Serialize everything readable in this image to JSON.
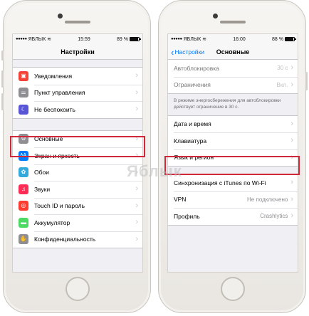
{
  "watermark": "Яблык",
  "left_phone": {
    "status": {
      "carrier": "ЯБЛЫК",
      "time": "15:59",
      "battery_text": "89 %",
      "battery_level": 0.89
    },
    "nav": {
      "title": "Настройки"
    },
    "groups": [
      [
        {
          "label": "Уведомления",
          "icon": "notifications-icon",
          "color": "#f44336",
          "glyph": "▣"
        },
        {
          "label": "Пункт управления",
          "icon": "control-center-icon",
          "color": "#8e8e93",
          "glyph": "⚌"
        },
        {
          "label": "Не беспокоить",
          "icon": "moon-icon",
          "color": "#5856d6",
          "glyph": "☾"
        }
      ],
      [
        {
          "label": "Основные",
          "icon": "gear-icon",
          "color": "#8e8e93",
          "glyph": "⚙"
        },
        {
          "label": "Экран и яркость",
          "icon": "display-brightness-icon",
          "color": "#007aff",
          "glyph": "ᴬA"
        },
        {
          "label": "Обои",
          "icon": "wallpaper-icon",
          "color": "#34aadc",
          "glyph": "✿"
        },
        {
          "label": "Звуки",
          "icon": "sound-icon",
          "color": "#ff2d55",
          "glyph": "♫"
        },
        {
          "label": "Touch ID и пароль",
          "icon": "fingerprint-icon",
          "color": "#ff3b30",
          "glyph": "◎"
        },
        {
          "label": "Аккумулятор",
          "icon": "battery-icon",
          "color": "#4cd964",
          "glyph": "▬"
        },
        {
          "label": "Конфиденциальность",
          "icon": "privacy-hand-icon",
          "color": "#8e8e93",
          "glyph": "✋"
        }
      ]
    ]
  },
  "right_phone": {
    "status": {
      "carrier": "ЯБЛЫК",
      "time": "16:00",
      "battery_text": "88 %",
      "battery_level": 0.88
    },
    "nav": {
      "back": "Настройки",
      "title": "Основные"
    },
    "group1": [
      {
        "label": "Автоблокировка",
        "value": "30 с"
      },
      {
        "label": "Ограничения",
        "value": "Вкл."
      }
    ],
    "note": "В режиме энергосбережения для автоблокировки действует ограничение в 30 с.",
    "group2": [
      {
        "label": "Дата и время",
        "value": ""
      },
      {
        "label": "Клавиатура",
        "value": ""
      },
      {
        "label": "Язык и регион",
        "value": ""
      }
    ],
    "group3": [
      {
        "label": "Синхронизация с iTunes по Wi-Fi",
        "value": ""
      },
      {
        "label": "VPN",
        "value": "Не подключено"
      },
      {
        "label": "Профиль",
        "value": "Crashlytics"
      }
    ]
  }
}
